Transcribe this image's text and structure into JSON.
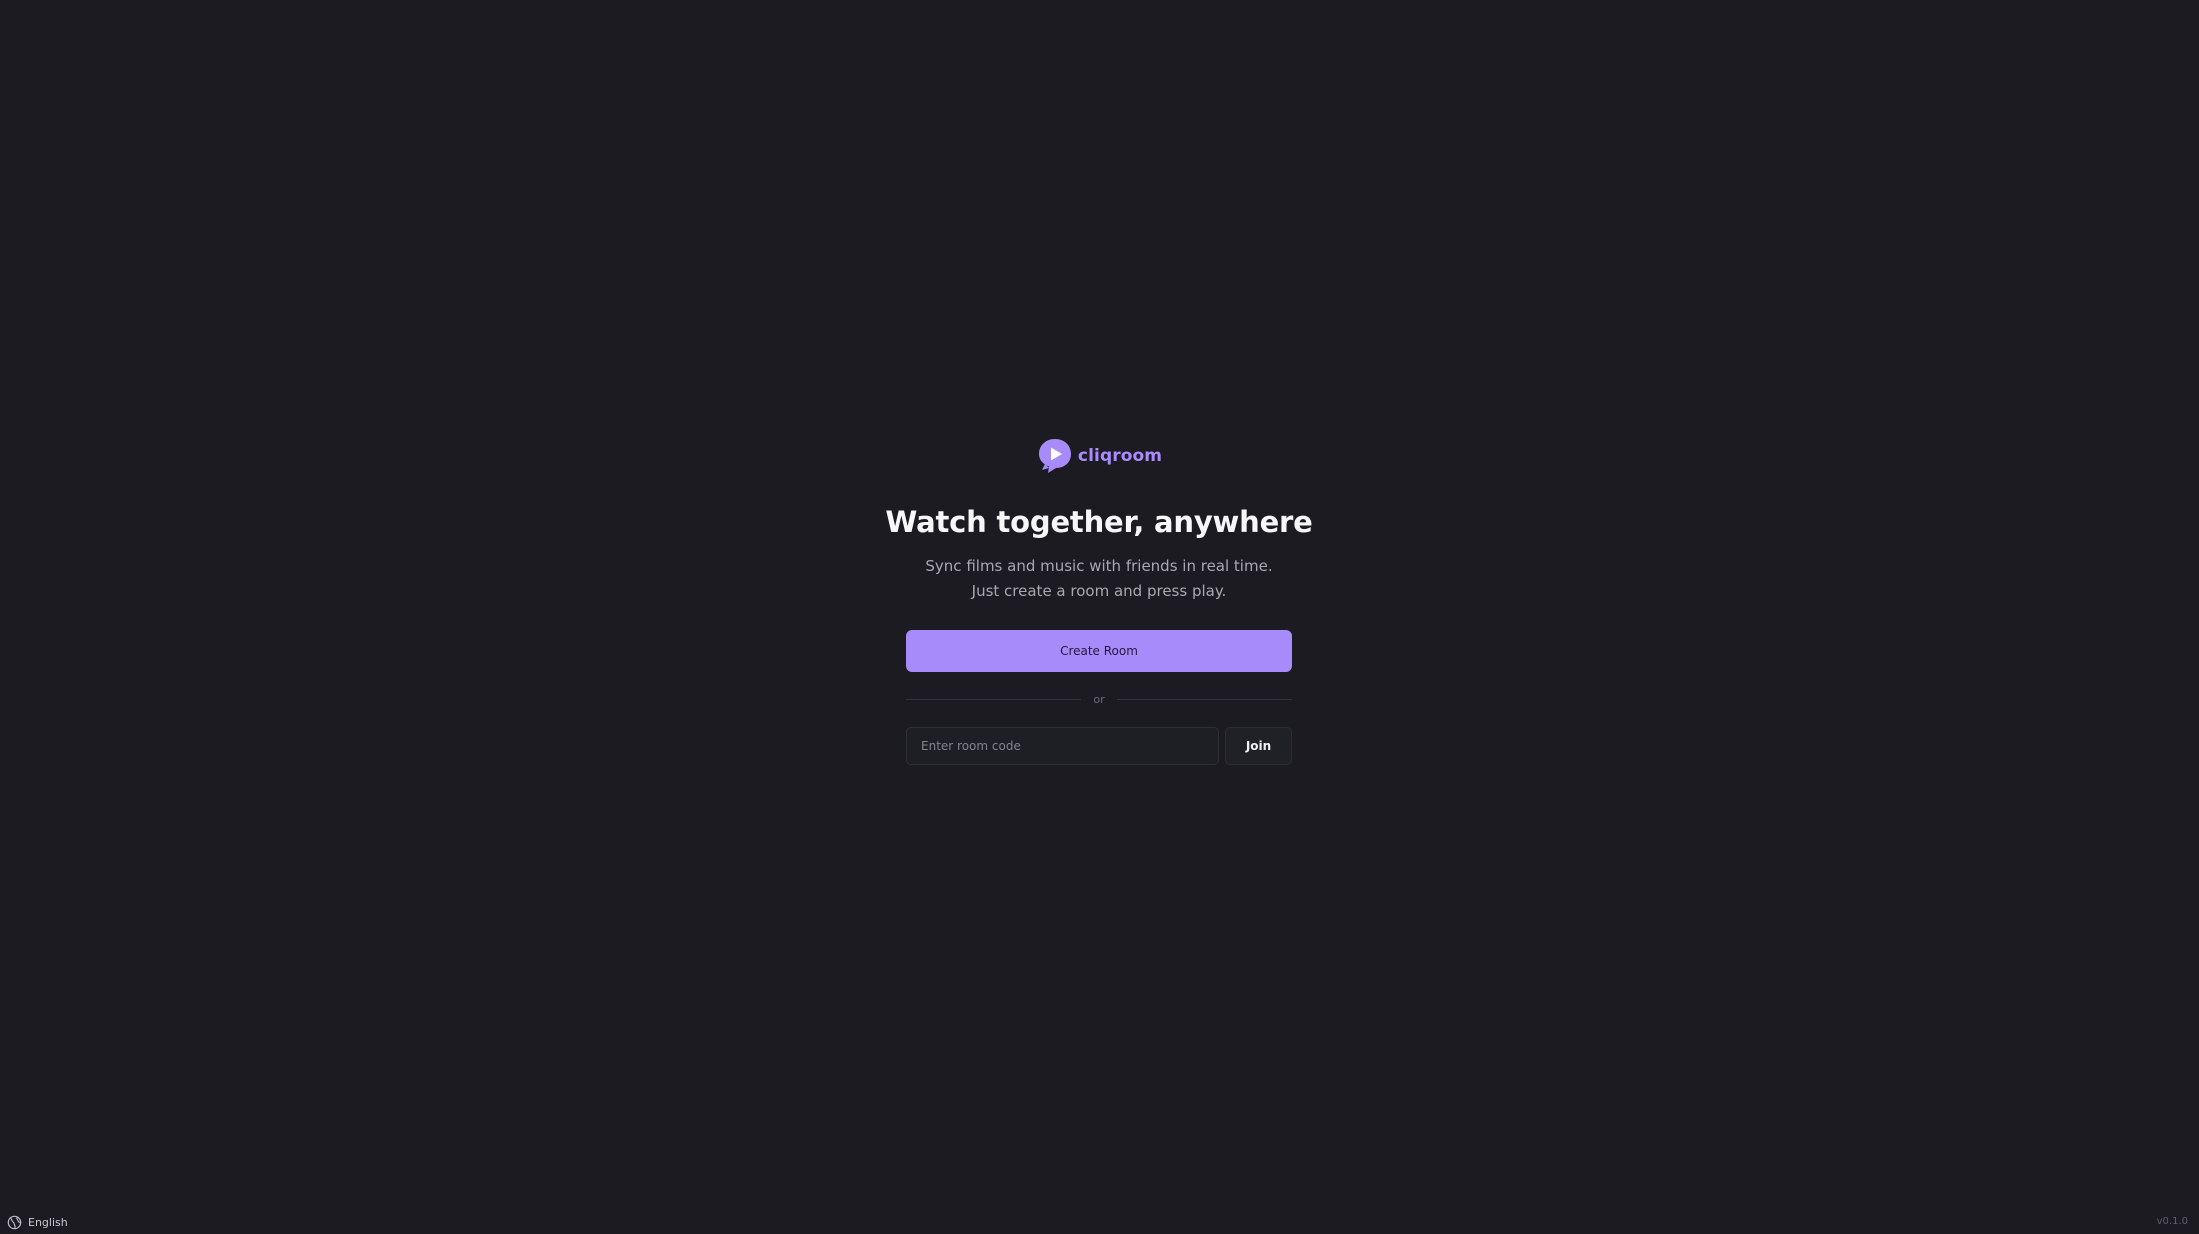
{
  "brand": {
    "name": "cliqroom",
    "logo_icon": "play-bubble-icon",
    "accent_color": "#a78bfa"
  },
  "hero": {
    "title": "Watch together, anywhere",
    "subtitle": "Sync films and music with friends in real time. Just create a room and press play."
  },
  "actions": {
    "create_label": "Create Room",
    "divider_label": "or",
    "room_code_value": "",
    "room_code_placeholder": "Enter room code",
    "join_label": "Join"
  },
  "footer": {
    "language_icon": "globe-icon",
    "language_label": "English",
    "version": "v0.1.0"
  }
}
